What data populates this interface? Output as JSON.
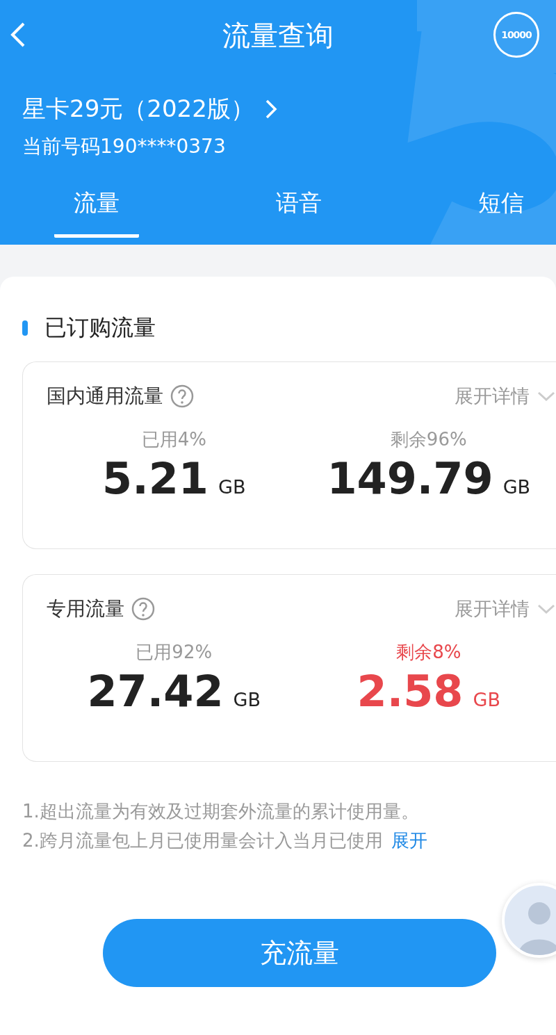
{
  "header": {
    "title": "流量查询",
    "service_logo": "10000",
    "plan_name": "星卡29元（2022版）",
    "phone_number": "当前号码190****0373"
  },
  "tabs": [
    {
      "label": "流量",
      "selected": true
    },
    {
      "label": "语音",
      "selected": false
    },
    {
      "label": "短信",
      "selected": false
    }
  ],
  "section_title": "已订购流量",
  "cards": [
    {
      "title": "国内通用流量",
      "expand_link": "展开详情",
      "used_label": "已用4%",
      "used_value": "5.21",
      "used_unit": "GB",
      "remaining_label": "剩余96%",
      "remaining_value": "149.79",
      "remaining_unit": "GB",
      "low": false
    },
    {
      "title": "专用流量",
      "expand_link": "展开详情",
      "used_label": "已用92%",
      "used_value": "27.42",
      "used_unit": "GB",
      "remaining_label": "剩余8%",
      "remaining_value": "2.58",
      "remaining_unit": "GB",
      "low": true
    }
  ],
  "notes": [
    "1.超出流量为有效及过期套外流量的累计使用量。",
    "2.跨月流量包上月已使用量会计入当月已使用"
  ],
  "notes_expand_link": "展开",
  "recharge_button": "充流量"
}
